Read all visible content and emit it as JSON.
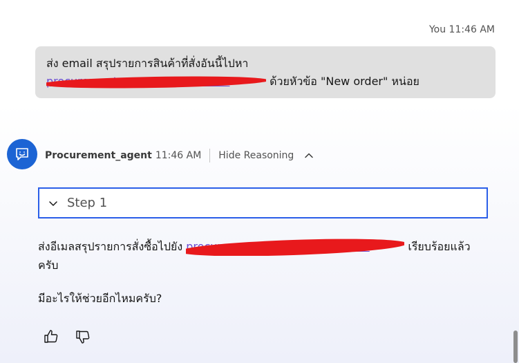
{
  "user_message": {
    "sender": "You",
    "time": "11:46 AM",
    "text_line1": "ส่ง email สรุปรายการสินค้าที่สั่งอันนี้ไปหา",
    "email": "procurement.manager@ibm.com",
    "text_line2_rest": " ด้วยหัวข้อ \"New order\" หน่อย"
  },
  "agent": {
    "name": "Procurement_agent",
    "time": "11:46 AM",
    "hide_reasoning_label": "Hide Reasoning",
    "step_label": "Step 1",
    "reply_before_email": "ส่งอีเมลสรุปรายการสั่งซื้อไปยัง ",
    "email": "procurement.manager@ibm.com",
    "reply_after_email": " เรียบร้อยแล้วครับ",
    "followup": "มีอะไรให้ช่วยอีกไหมครับ?"
  },
  "colors": {
    "accent": "#2a5ee8",
    "avatar_bg": "#1c64d4",
    "bubble_bg": "#e0e0e0",
    "redaction": "#e8191c",
    "link": "#6d4dd1"
  },
  "icons": {
    "avatar": "chat-bot-icon",
    "collapse": "chevron-up-icon",
    "step_toggle": "chevron-down-icon",
    "like": "thumbs-up-icon",
    "dislike": "thumbs-down-icon"
  }
}
